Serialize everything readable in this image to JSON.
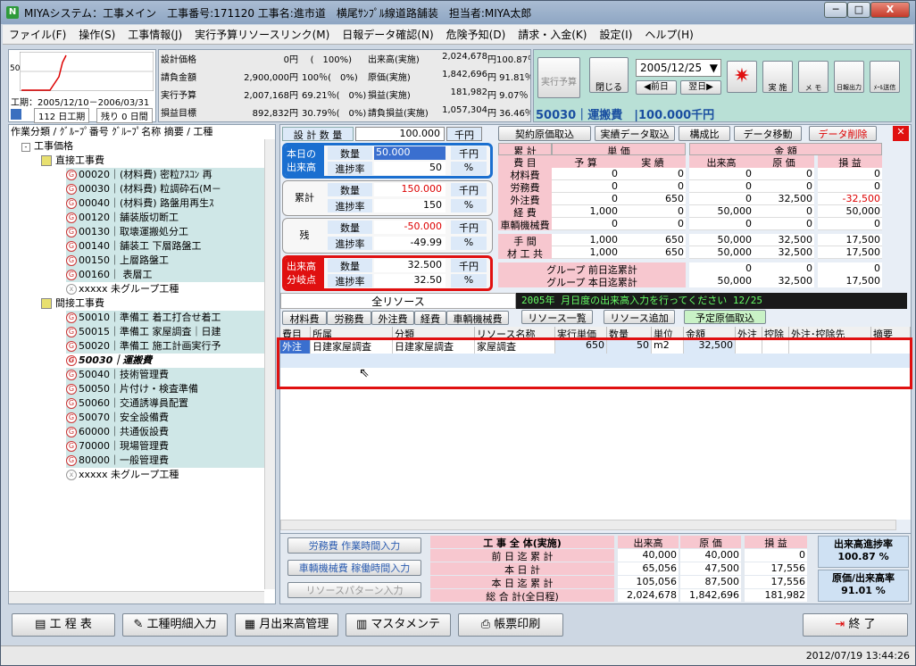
{
  "window": {
    "title": "MIYAシステム：工事メイン　工事番号:171120 工事名:進市道　横尾ｻﾝﾌﾟﾙ線道路舗装　担当者:MIYA太郎",
    "app_icon": "N",
    "min": "─",
    "max": "□",
    "close": "X"
  },
  "menu": [
    "ファイル(F)",
    "操作(S)",
    "工事情報(J)",
    "実行予算リソースリンク(M)",
    "日報データ確認(N)",
    "危険予知(D)",
    "請求・入金(K)",
    "設定(I)",
    "ヘルプ(H)"
  ],
  "mini_chart": {
    "label": "50",
    "period": "工期：2005/12/10－2006/03/31",
    "days": "112 日工期",
    "remain": "残り 0 日間"
  },
  "summary": {
    "rows": [
      {
        "l": "設計価格",
        "v": "0円",
        "p": "(　100%)",
        "l2": "出来高(実施)",
        "v2": "2,024,678",
        "p2": "円100.87％"
      },
      {
        "l": "請負金額",
        "v": "2,900,000円",
        "p": "100％(　0%)",
        "l2": "原価(実施)",
        "v2": "1,842,696",
        "p2": "円 91.81％"
      },
      {
        "l": "実行予算",
        "v": "2,007,168円",
        "p": "69.21％(　0%)",
        "l2": "損益(実施)",
        "v2": "181,982",
        "p2": "円 9.07％"
      },
      {
        "l": "損益目標",
        "v": "892,832円",
        "p": "30.79％(　0%)",
        "l2": "請負損益(実施)",
        "v2": "1,057,304",
        "p2": "円 36.46％"
      }
    ]
  },
  "toolbar": {
    "jikko_yosan": "実行予算",
    "close": "閉じる",
    "date": "2005/12/25",
    "prev": "前日",
    "next": "翌日",
    "jisshi": "実 施",
    "memo": "メ モ",
    "nippo": "日報出力",
    "mail": "ﾒｰﾙ送信",
    "status": "50030｜運搬費　|100.000千円"
  },
  "tree": {
    "header": "作業分類 / ｸﾞﾙｰﾌﾟ番号 ｸﾞﾙｰﾌﾟ名称 摘要 / 工種",
    "root": "工事価格",
    "g1": "直接工事費",
    "items1": [
      "00020｜(材料費) 密粒ｱｽｺﾝ 再",
      "00030｜(材料費) 粒調砕石(M－",
      "00040｜(材料費) 路盤用再生ｽ",
      "00120｜舗装版切断工",
      "00130｜取壊運搬処分工",
      "00140｜舗装工 下層路盤工",
      "00150｜上層路盤工",
      "00160｜ 表層工"
    ],
    "ungroup1": "xxxxx 未グループ工種",
    "g2": "間接工事費",
    "items2": [
      "50010｜準備工 着工打合せ着工",
      "50015｜準備工 家屋調査｜日建",
      "50020｜準備工 施工計画実行予"
    ],
    "selected": "50030｜運搬費",
    "items3": [
      "50040｜技術管理費",
      "50050｜片付け・検査準備",
      "50060｜交通誘導員配置",
      "50070｜安全設備費",
      "60000｜共通仮設費",
      "70000｜現場管理費",
      "80000｜一般管理費"
    ],
    "ungroup2": "xxxxx 未グループ工種"
  },
  "design": {
    "label": "設 計 数 量",
    "value": "100.000",
    "unit": "千円"
  },
  "buttons_top": [
    "契約原価取込",
    "実績データ取込",
    "構成比",
    "データ移動",
    "データ削除"
  ],
  "today": {
    "title": "本日の出来高",
    "qty_label": "数量",
    "qty": "50.000",
    "qty_unit": "千円",
    "rate_label": "進捗率",
    "rate": "50",
    "rate_unit": "%"
  },
  "cumulative": {
    "title": "累計",
    "qty_label": "数量",
    "qty": "150.000",
    "qty_unit": "千円",
    "rate_label": "進捗率",
    "rate": "150",
    "rate_unit": "%"
  },
  "remain": {
    "title": "残",
    "qty_label": "数量",
    "qty": "-50.000",
    "qty_unit": "千円",
    "rate_label": "進捗率",
    "rate": "-49.99",
    "rate_unit": "%"
  },
  "breakeven": {
    "title": "出来高分岐点",
    "qty_label": "数量",
    "qty": "32.500",
    "qty_unit": "千円",
    "rate_label": "進捗率",
    "rate": "32.50",
    "rate_unit": "%"
  },
  "cost_table": {
    "h1": "累 計",
    "h2": "単 価",
    "h3": "金 額",
    "cols": [
      "費 目",
      "予 算",
      "実 績",
      "出来高",
      "原 価",
      "損 益"
    ],
    "rows": [
      [
        "材料費",
        "0",
        "0",
        "0",
        "0",
        "0"
      ],
      [
        "労務費",
        "0",
        "0",
        "0",
        "0",
        "0"
      ],
      [
        "外注費",
        "0",
        "650",
        "0",
        "32,500",
        "-32,500"
      ],
      [
        "経 費",
        "1,000",
        "0",
        "50,000",
        "0",
        "50,000"
      ],
      [
        "車輌機械費",
        "0",
        "0",
        "0",
        "0",
        "0"
      ],
      [
        "手 間",
        "1,000",
        "650",
        "50,000",
        "32,500",
        "17,500"
      ],
      [
        "材 工 共",
        "1,000",
        "650",
        "50,000",
        "32,500",
        "17,500"
      ]
    ],
    "g_prev": "グループ 前日迄累計",
    "g_prev_vals": [
      "0",
      "0",
      "0"
    ],
    "g_today": "グループ 本日迄累計",
    "g_today_vals": [
      "50,000",
      "32,500",
      "17,500"
    ]
  },
  "resource": {
    "all_tab": "全リソース",
    "ticker": "2005年 月日度の出来高入力を行ってください 12/25",
    "tabs": [
      "材料費",
      "労務費",
      "外注費",
      "経費",
      "車輌機械費"
    ],
    "btn_list": "リソース一覧",
    "btn_add": "リソース追加",
    "btn_import": "予定原価取込",
    "cols": [
      "費目",
      "所属",
      "分類",
      "リソース名称",
      "実行単価",
      "数量",
      "単位",
      "金額",
      "外注",
      "控除",
      "外注･控除先",
      "摘要"
    ],
    "row": [
      "外注",
      "日建家屋調査",
      "日建家屋調査",
      "家屋調査",
      "650",
      "50",
      "m2",
      "32,500",
      "",
      "",
      "",
      ""
    ]
  },
  "bottom_left_btns": [
    "労務費 作業時間入力",
    "車輌機械費 稼働時間入力",
    "リソースパターン入力"
  ],
  "overall": {
    "title": "工 事 全 体(実施)",
    "cols": [
      "出来高",
      "原 価",
      "損 益"
    ],
    "rows": [
      [
        "前 日 迄 累 計",
        "40,000",
        "40,000",
        "0"
      ],
      [
        "本 日 計",
        "65,056",
        "47,500",
        "17,556"
      ],
      [
        "本 日 迄 累 計",
        "105,056",
        "87,500",
        "17,556"
      ],
      [
        "総 合 計(全日程)",
        "2,024,678",
        "1,842,696",
        "181,982"
      ]
    ],
    "rate1_label": "出来高進捗率",
    "rate1": "100.87 %",
    "rate2_label": "原価/出来高率",
    "rate2": "91.01 %"
  },
  "footer_btns": [
    "工 程 表",
    "工種明細入力",
    "月出来高管理",
    "マスタメンテ",
    "帳票印刷",
    "終 了"
  ],
  "statusbar": "2012/07/19 13:44:26",
  "colors": {
    "accent_red": "#e01010",
    "blue_box": "#1a6fd0",
    "highlight": "#cfe7e7"
  }
}
